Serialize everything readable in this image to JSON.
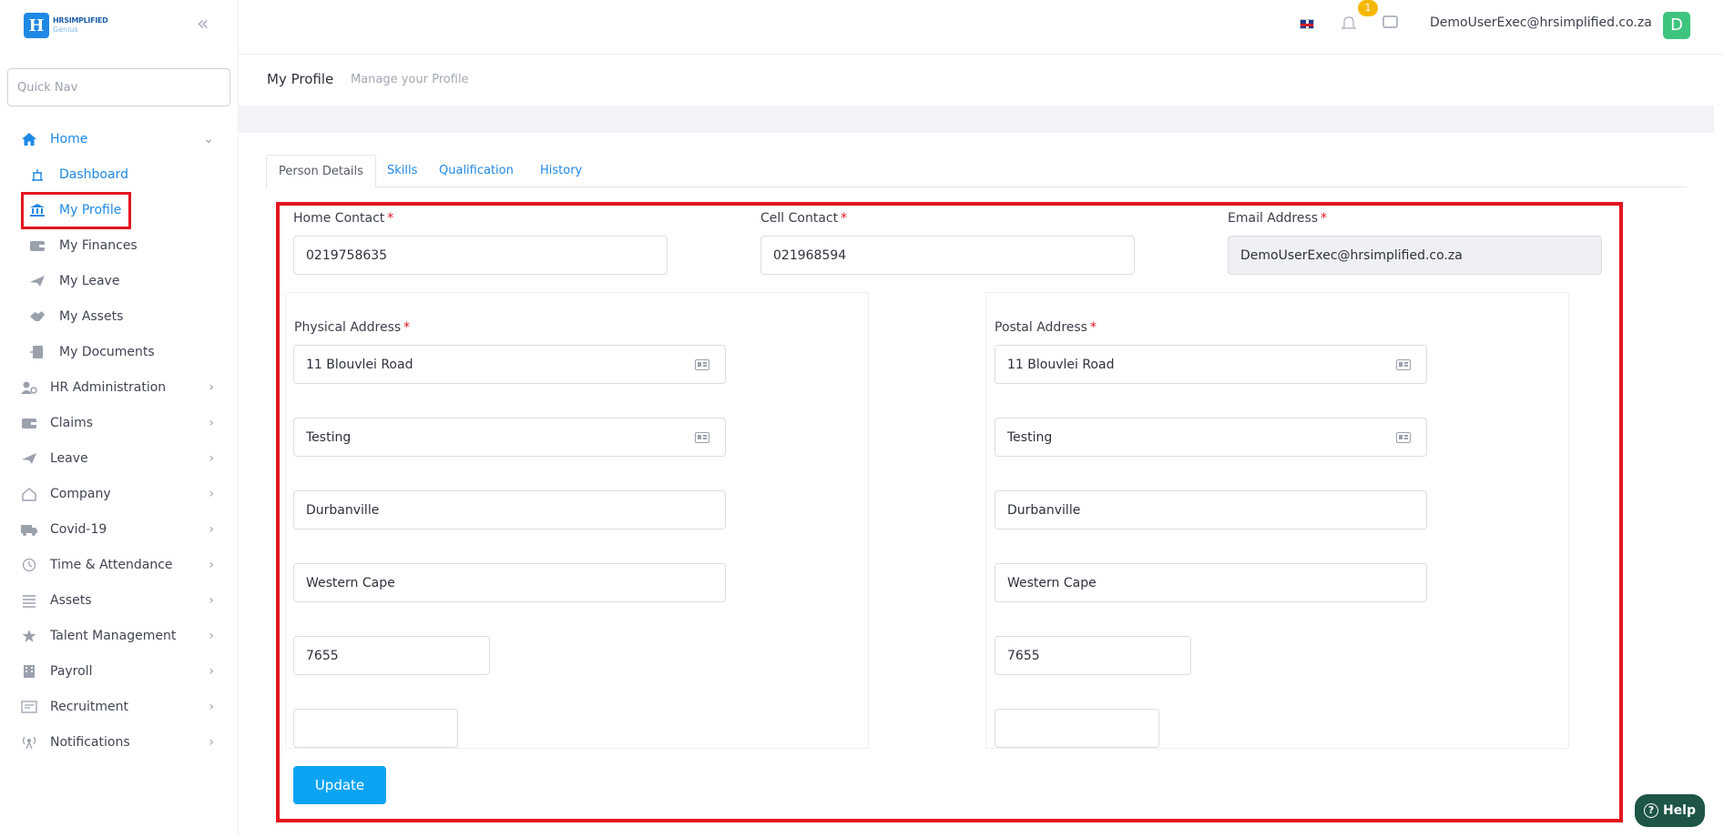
{
  "logo": {
    "line1": "HRSIMPLIFIED",
    "line2": "Genius",
    "mark": "H"
  },
  "sidebar": {
    "quicknav_placeholder": "Quick Nav",
    "home": {
      "label": "Home",
      "icon": "home-icon"
    },
    "subitems": [
      {
        "label": "Dashboard",
        "icon": "dashboard-icon"
      },
      {
        "label": "My Profile",
        "icon": "bank-icon"
      },
      {
        "label": "My Finances",
        "icon": "wallet-icon"
      },
      {
        "label": "My Leave",
        "icon": "plane-icon"
      },
      {
        "label": "My Assets",
        "icon": "handshake-icon"
      },
      {
        "label": "My Documents",
        "icon": "documents-icon"
      }
    ],
    "items": [
      {
        "label": "HR Administration",
        "icon": "user-cog-icon"
      },
      {
        "label": "Claims",
        "icon": "wallet-icon"
      },
      {
        "label": "Leave",
        "icon": "plane-icon"
      },
      {
        "label": "Company",
        "icon": "house-icon"
      },
      {
        "label": "Covid-19",
        "icon": "ambulance-icon"
      },
      {
        "label": "Time & Attendance",
        "icon": "clock-icon"
      },
      {
        "label": "Assets",
        "icon": "list-icon"
      },
      {
        "label": "Talent Management",
        "icon": "star-icon"
      },
      {
        "label": "Payroll",
        "icon": "building-icon"
      },
      {
        "label": "Recruitment",
        "icon": "recruitment-icon"
      },
      {
        "label": "Notifications",
        "icon": "broadcast-icon"
      }
    ]
  },
  "header": {
    "notification_count": "1",
    "user_email": "DemoUserExec@hrsimplified.co.za",
    "avatar_letter": "D"
  },
  "page": {
    "title": "My Profile",
    "subtitle": "Manage your Profile"
  },
  "tabs": [
    "Person Details",
    "Skills",
    "Qualification",
    "History"
  ],
  "form": {
    "home_contact": {
      "label": "Home Contact",
      "value": "0219758635"
    },
    "cell_contact": {
      "label": "Cell Contact",
      "value": "021968594"
    },
    "email": {
      "label": "Email Address",
      "value": "DemoUserExec@hrsimplified.co.za"
    },
    "physical": {
      "label": "Physical Address",
      "line1": "11 Blouvlei Road",
      "line2": "Testing",
      "city": "Durbanville",
      "province": "Western Cape",
      "code": "7655",
      "extra": ""
    },
    "postal": {
      "label": "Postal Address",
      "line1": "11 Blouvlei Road",
      "line2": "Testing",
      "city": "Durbanville",
      "province": "Western Cape",
      "code": "7655",
      "extra": ""
    },
    "required_mark": "*",
    "update_label": "Update"
  },
  "help_label": "Help",
  "colors": {
    "accent": "#1e88e5",
    "highlight": "#e3141f",
    "button": "#0ba4f3",
    "help": "#1e5546"
  }
}
